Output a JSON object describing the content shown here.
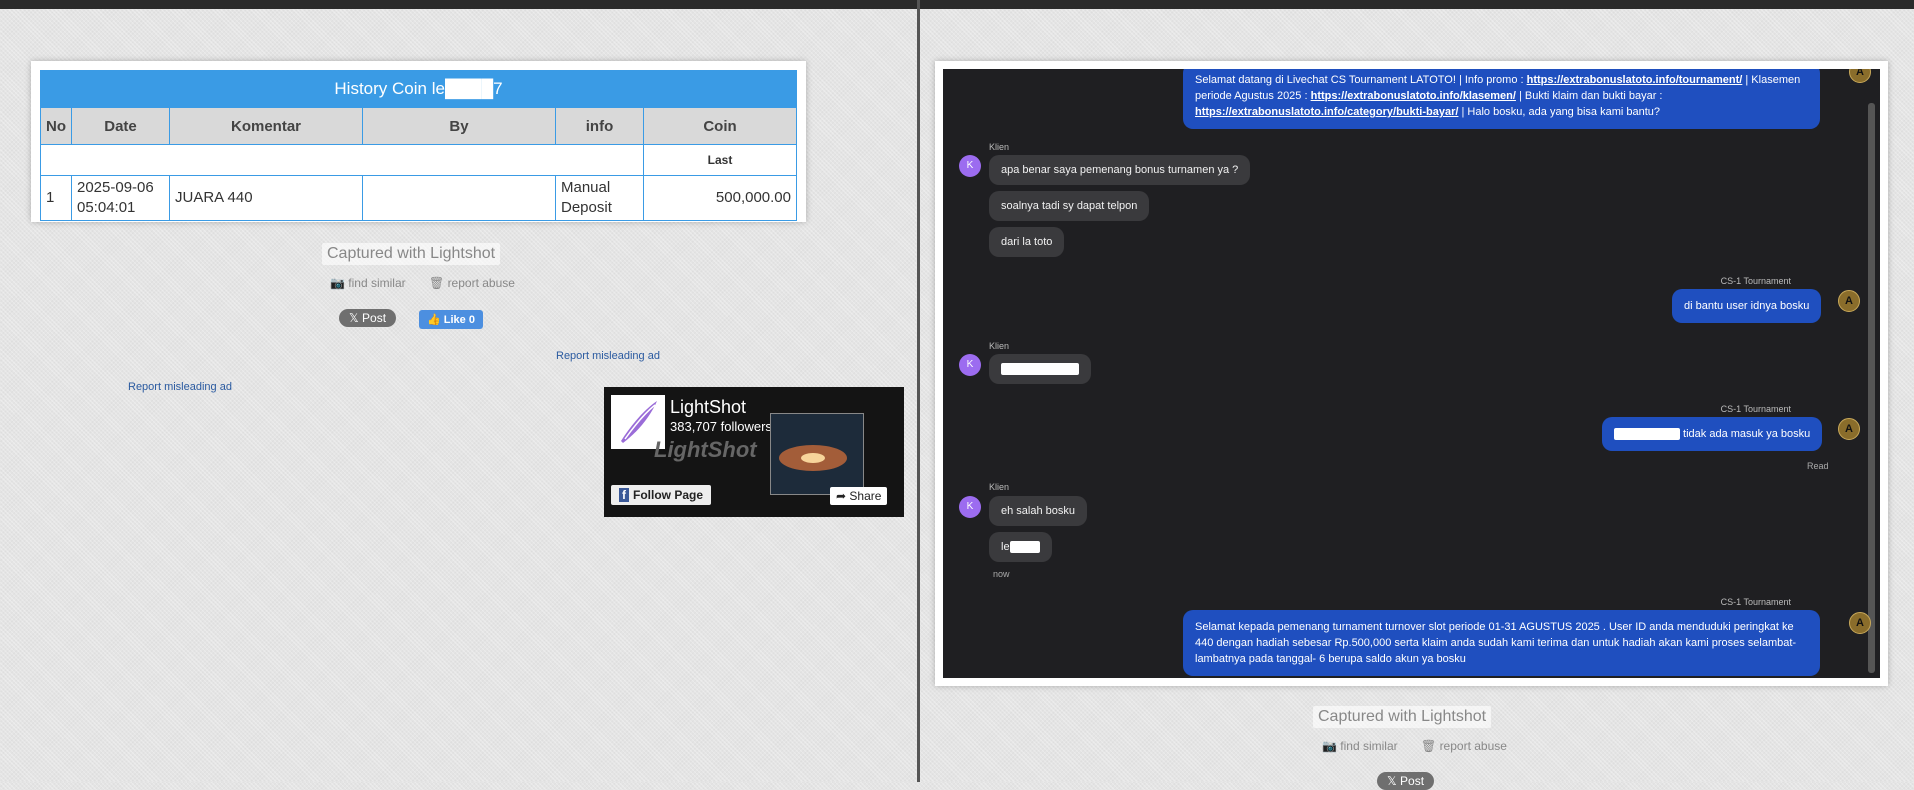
{
  "history": {
    "title": "History Coin le████7",
    "columns": [
      "No",
      "Date",
      "Komentar",
      "By",
      "info",
      "Coin"
    ],
    "last_label": "Last",
    "rows": [
      {
        "no": "1",
        "date_line1": "2025-09-06",
        "date_line2": "05:04:01",
        "komentar": "JUARA 440",
        "by": "",
        "info_line1": "Manual",
        "info_line2": "Deposit",
        "coin": "500,000.00"
      }
    ]
  },
  "left_footer": {
    "captured": "Captured with Lightshot",
    "find_similar": "find similar",
    "report_abuse": "report abuse",
    "post": "Post",
    "like": "Like 0",
    "report_ad_1": "Report misleading ad",
    "report_ad_2": "Report misleading ad"
  },
  "lightshot_ad": {
    "name": "LightShot",
    "followers": "383,707 followers",
    "watermark": "LightShot",
    "follow": "Follow Page",
    "share": "Share"
  },
  "chat": {
    "welcome": {
      "t1": "Selamat datang di Livechat CS Tournament LATOTO! | Info promo : ",
      "l1": "https://extrabonuslatoto.info/tournament/",
      "t2": " | Klasemen periode Agustus 2025 : ",
      "l2": "https://extrabonuslatoto.info/klasemen/",
      "t3": " | Bukti klaim dan bukti bayar : ",
      "l3": "https://extrabonuslatoto.info/category/bukti-bayar/",
      "t4": " | Halo bosku, ada yang bisa kami bantu?"
    },
    "client_label": "Klien",
    "agent_label": "CS-1 Tournament",
    "client_initial": "K",
    "agent_initial": "A",
    "m1": "apa benar saya pemenang bonus turnamen ya ?",
    "m2": "soalnya tadi sy dapat telpon",
    "m3": "dari la toto",
    "m4": "di bantu user idnya bosku",
    "m6_suffix": " tidak ada masuk ya bosku",
    "read": "Read",
    "m7": "eh salah bosku",
    "m8_prefix": "le",
    "now": "now",
    "m9": "Selamat kepada pemenang turnament turnover slot periode 01-31 AGUSTUS 2025 . User ID anda menduduki peringkat ke 440 dengan hadiah sebesar Rp.500,000 serta klaim anda sudah kami terima dan untuk hadiah akan kami proses selambat-lambatnya pada tanggal- 6 berupa saldo akun ya bosku"
  },
  "right_footer": {
    "captured": "Captured with Lightshot",
    "find_similar": "find similar",
    "report_abuse": "report abuse",
    "post": "Post"
  }
}
